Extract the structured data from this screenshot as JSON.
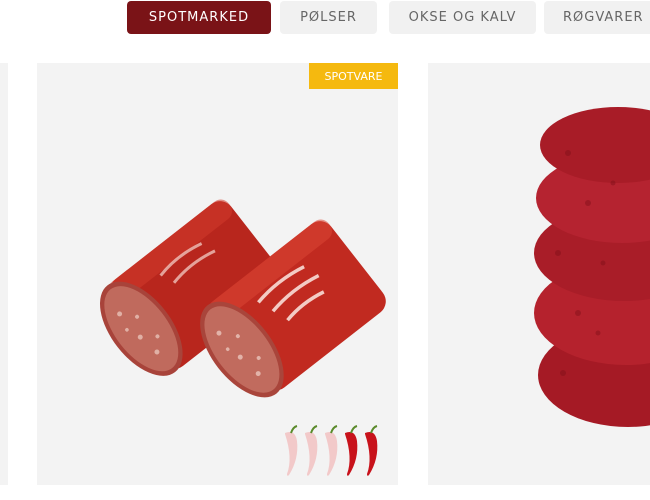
{
  "filters": [
    {
      "label": "SPOTMARKED",
      "active": true
    },
    {
      "label": "PØLSER",
      "active": false
    },
    {
      "label": "OKSE OG KALV",
      "active": false
    },
    {
      "label": "RØGVARER",
      "active": false
    }
  ],
  "products": {
    "left_partial": {
      "image": "product-image"
    },
    "featured": {
      "badge": "SPOTVARE",
      "image": "chili-sausage-image",
      "heat_level": 2,
      "heat_max": 5
    },
    "right_partial": {
      "image": "beef-patties-image"
    }
  },
  "colors": {
    "accent": "#7a1317",
    "badge": "#f5b90f",
    "button_bg": "#f1f1f1",
    "button_text": "#666666",
    "card_bg": "#f3f3f3"
  }
}
